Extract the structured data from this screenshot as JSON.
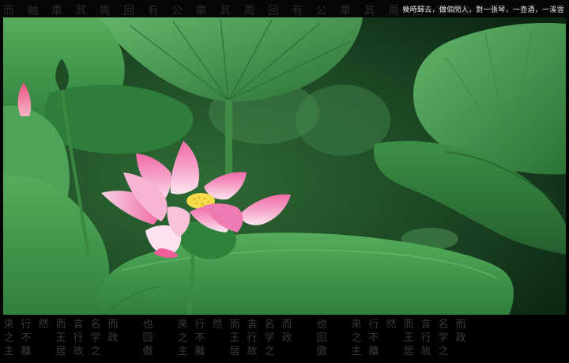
{
  "caption": "幾時歸去，做個閒人，對一張琴，一壺酒，一溪雲",
  "top_calligraphy": "而 軸 車 其 周 回 有 公 車 其 周 回 有 公 車 其 周 回 有 公",
  "bottom_calligraphy_columns": [
    "來之主",
    "行不離",
    "然",
    "而王居",
    "言行故",
    "名学之",
    "而 政",
    "",
    "也回傲",
    "",
    "來之主",
    "行不離",
    "然",
    "而王居",
    "言行故",
    "名学之",
    "而 政",
    "",
    "也回傲",
    "",
    "來之主",
    "行不離",
    "然",
    "而王居",
    "言行故",
    "名学之",
    "而 政"
  ],
  "colors": {
    "lotus_petal": "#f29bc4",
    "lotus_center": "#f4e55a",
    "leaf_green": "#3f9a4f",
    "background_dark_green": "#12351c"
  },
  "icons": {
    "subject": "lotus-flower",
    "border_decoration": "calligraphy-strip"
  }
}
